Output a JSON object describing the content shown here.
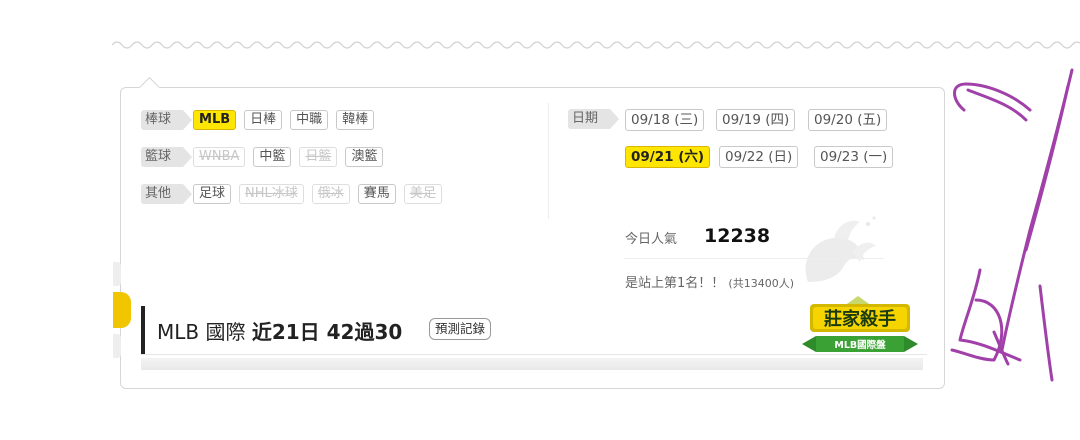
{
  "sports": [
    {
      "category": "棒球",
      "tags": [
        {
          "label": "MLB",
          "state": "active"
        },
        {
          "label": "日棒",
          "state": "normal"
        },
        {
          "label": "中職",
          "state": "normal"
        },
        {
          "label": "韓棒",
          "state": "normal"
        }
      ]
    },
    {
      "category": "籃球",
      "tags": [
        {
          "label": "WNBA",
          "state": "disabled"
        },
        {
          "label": "中籃",
          "state": "normal"
        },
        {
          "label": "日籃",
          "state": "disabled"
        },
        {
          "label": "澳籃",
          "state": "normal"
        }
      ]
    },
    {
      "category": "其他",
      "tags": [
        {
          "label": "足球",
          "state": "normal"
        },
        {
          "label": "NHL冰球",
          "state": "disabled"
        },
        {
          "label": "俄冰",
          "state": "disabled"
        },
        {
          "label": "賽馬",
          "state": "normal"
        },
        {
          "label": "美足",
          "state": "disabled"
        }
      ]
    }
  ],
  "dates": {
    "label": "日期",
    "items": [
      {
        "label": "09/18 (三)",
        "active": false
      },
      {
        "label": "09/19 (四)",
        "active": false
      },
      {
        "label": "09/20 (五)",
        "active": false
      },
      {
        "label": "09/21 (六)",
        "active": true
      },
      {
        "label": "09/22 (日)",
        "active": false
      },
      {
        "label": "09/23 (一)",
        "active": false
      }
    ]
  },
  "stats": {
    "popularity_label": "今日人氣",
    "popularity_value": "12238",
    "rank_text": "是站上第1名！！",
    "rank_total": "(共13400人)"
  },
  "record": {
    "prefix": "MLB 國際",
    "summary": "近21日 42過30",
    "button_label": "預測記錄"
  },
  "badge": {
    "title": "莊家殺手",
    "subtitle": "MLB國際盤"
  },
  "colors": {
    "accent": "#ffe600",
    "scribble": "#a040a8"
  }
}
